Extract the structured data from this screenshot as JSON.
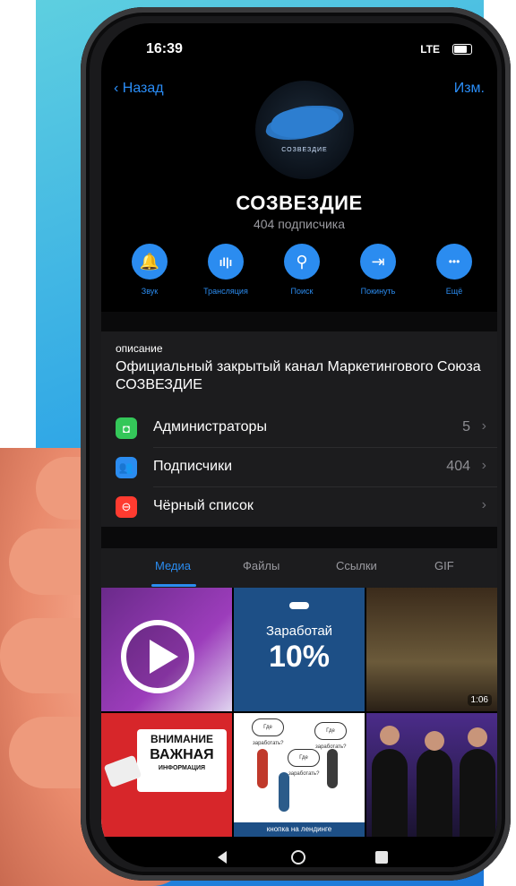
{
  "status_bar": {
    "time": "16:39",
    "network": "LTE"
  },
  "nav": {
    "back_label": "Назад",
    "edit_label": "Изм."
  },
  "channel": {
    "avatar_text": "СОЗВЕЗДИЕ",
    "title": "СОЗВЕЗДИЕ",
    "subscribers": "404 подписчика"
  },
  "actions": [
    {
      "label": "Звук",
      "icon": "bell-icon",
      "glyph": "🔔"
    },
    {
      "label": "Трансляция",
      "icon": "broadcast-icon",
      "glyph": "ıl|ı"
    },
    {
      "label": "Поиск",
      "icon": "search-icon",
      "glyph": "⚲"
    },
    {
      "label": "Покинуть",
      "icon": "leave-icon",
      "glyph": "⇥"
    },
    {
      "label": "Ещё",
      "icon": "more-icon",
      "glyph": "•••"
    }
  ],
  "description": {
    "label": "описание",
    "text": "Официальный закрытый канал Маркетингового Союза СОЗВЕЗДИЕ"
  },
  "rows": [
    {
      "label": "Администраторы",
      "count": "5",
      "icon": "admin-shield-icon",
      "color": "#34c759"
    },
    {
      "label": "Подписчики",
      "count": "404",
      "icon": "subscribers-icon",
      "color": "#2b8cf0"
    },
    {
      "label": "Чёрный список",
      "count": "",
      "icon": "blacklist-icon",
      "color": "#ff3b30"
    }
  ],
  "tabs": [
    "Медиа",
    "Файлы",
    "Ссылки",
    "GIF"
  ],
  "media": {
    "tile2_title": "Заработай",
    "tile2_percent": "10%",
    "tile3_duration": "1:06",
    "tile4_line1": "ВНИМАНИЕ",
    "tile4_line2": "ВАЖНАЯ",
    "tile4_line3": "ИНФОРМАЦИЯ",
    "tile5_bubble": "Где заработать?",
    "tile5_banner": "кнопка на лендинге"
  },
  "colors": {
    "accent": "#2b8cf0",
    "background": "#000000",
    "panel": "#1c1c1e"
  }
}
